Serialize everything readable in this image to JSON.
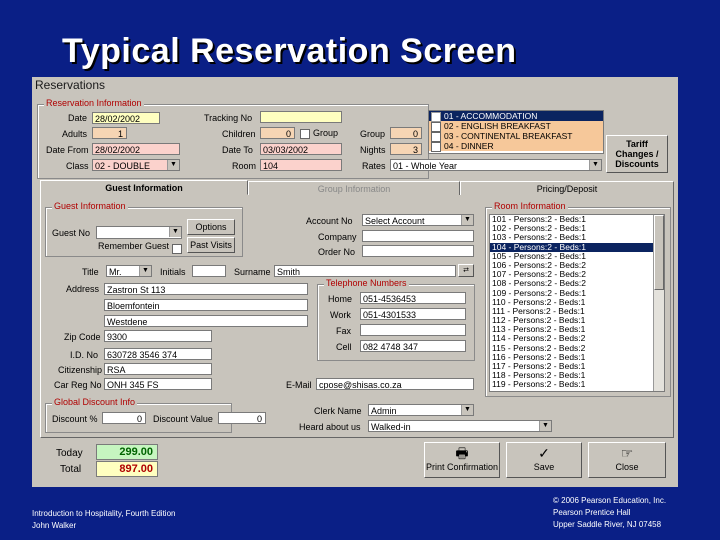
{
  "slide": {
    "title": "Typical Reservation Screen"
  },
  "window": {
    "title": "Reservations"
  },
  "reservation_info": {
    "title": "Reservation Information",
    "date_label": "Date",
    "date": "28/02/2002",
    "adults_label": "Adults",
    "adults": "1",
    "date_from_label": "Date From",
    "date_from": "28/02/2002",
    "class_label": "Class",
    "class": "02 - DOUBLE",
    "tracking_label": "Tracking No",
    "tracking": "",
    "children_label": "Children",
    "children": "0",
    "group_check_label": "Group",
    "date_to_label": "Date To",
    "date_to": "03/03/2002",
    "room_label": "Room",
    "room": "104",
    "group_label": "Group",
    "group": "0",
    "nights_label": "Nights",
    "nights": "3",
    "rates_label": "Rates",
    "rates": "01 - Whole Year"
  },
  "meal_plan": {
    "items": [
      "01 - ACCOMMODATION",
      "02 - ENGLISH BREAKFAST",
      "03 - CONTINENTAL BREAKFAST",
      "04 - DINNER"
    ]
  },
  "tariff_button": {
    "label_1": "Tariff",
    "label_2": "Changes /",
    "label_3": "Discounts"
  },
  "tabs": {
    "guest": "Guest Information",
    "group": "Group Information",
    "pricing": "Pricing/Deposit"
  },
  "guest_info": {
    "title": "Guest Information",
    "guest_no_label": "Guest No",
    "options_label": "Options",
    "remember_label": "Remember Guest",
    "past_visits_label": "Past Visits",
    "account_no_label": "Account No",
    "account_no": "Select Account",
    "company_label": "Company",
    "order_no_label": "Order No",
    "title_label": "Title",
    "title_value": "Mr.",
    "initials_label": "Initials",
    "surname_label": "Surname",
    "surname": "Smith",
    "address_label": "Address",
    "address_1": "Zastron St 113",
    "address_2": "Bloemfontein",
    "address_3": "Westdene",
    "zip_label": "Zip Code",
    "zip": "9300",
    "id_label": "I.D. No",
    "id": "630728 3546 374",
    "citizenship_label": "Citizenship",
    "citizenship": "RSA",
    "car_reg_label": "Car Reg No",
    "car_reg": "ONH 345 FS",
    "email_label": "E-Mail",
    "email": "cpose@shisas.co.za"
  },
  "telephone": {
    "title": "Telephone Numbers",
    "home_label": "Home",
    "home": "051-4536453",
    "work_label": "Work",
    "work": "051-4301533",
    "fax_label": "Fax",
    "fax": "",
    "cell_label": "Cell",
    "cell": "082 4748 347"
  },
  "room_info": {
    "title": "Room Information",
    "rooms": [
      "101 - Persons:2 - Beds:1",
      "102 - Persons:2 - Beds:1",
      "103 - Persons:2 - Beds:1",
      "104 - Persons:2 - Beds:1",
      "105 - Persons:2 - Beds:1",
      "106 - Persons:2 - Beds:2",
      "107 - Persons:2 - Beds:2",
      "108 - Persons:2 - Beds:2",
      "109 - Persons:2 - Beds:1",
      "110 - Persons:2 - Beds:1",
      "111 - Persons:2 - Beds:1",
      "112 - Persons:2 - Beds:1",
      "113 - Persons:2 - Beds:1",
      "114 - Persons:2 - Beds:2",
      "115 - Persons:2 - Beds:2",
      "116 - Persons:2 - Beds:1",
      "117 - Persons:2 - Beds:1",
      "118 - Persons:2 - Beds:1",
      "119 - Persons:2 - Beds:1"
    ]
  },
  "discount": {
    "title": "Global Discount Info",
    "pct_label": "Discount %",
    "pct": "0",
    "value_label": "Discount Value",
    "value": "0"
  },
  "clerk": {
    "clerk_label": "Clerk Name",
    "clerk": "Admin",
    "heard_label": "Heard about us",
    "heard": "Walked-in"
  },
  "totals": {
    "today_label": "Today",
    "today": "299.00",
    "total_label": "Total",
    "total": "897.00"
  },
  "actions": {
    "print": "Print Confirmation",
    "save": "Save",
    "close": "Close"
  },
  "footer": {
    "left_1": "Introduction to Hospitality, Fourth Edition",
    "left_2": "John Walker",
    "right_1": "© 2006 Pearson Education, Inc.",
    "right_2": "Pearson Prentice Hall",
    "right_3": "Upper Saddle River, NJ 07458"
  }
}
